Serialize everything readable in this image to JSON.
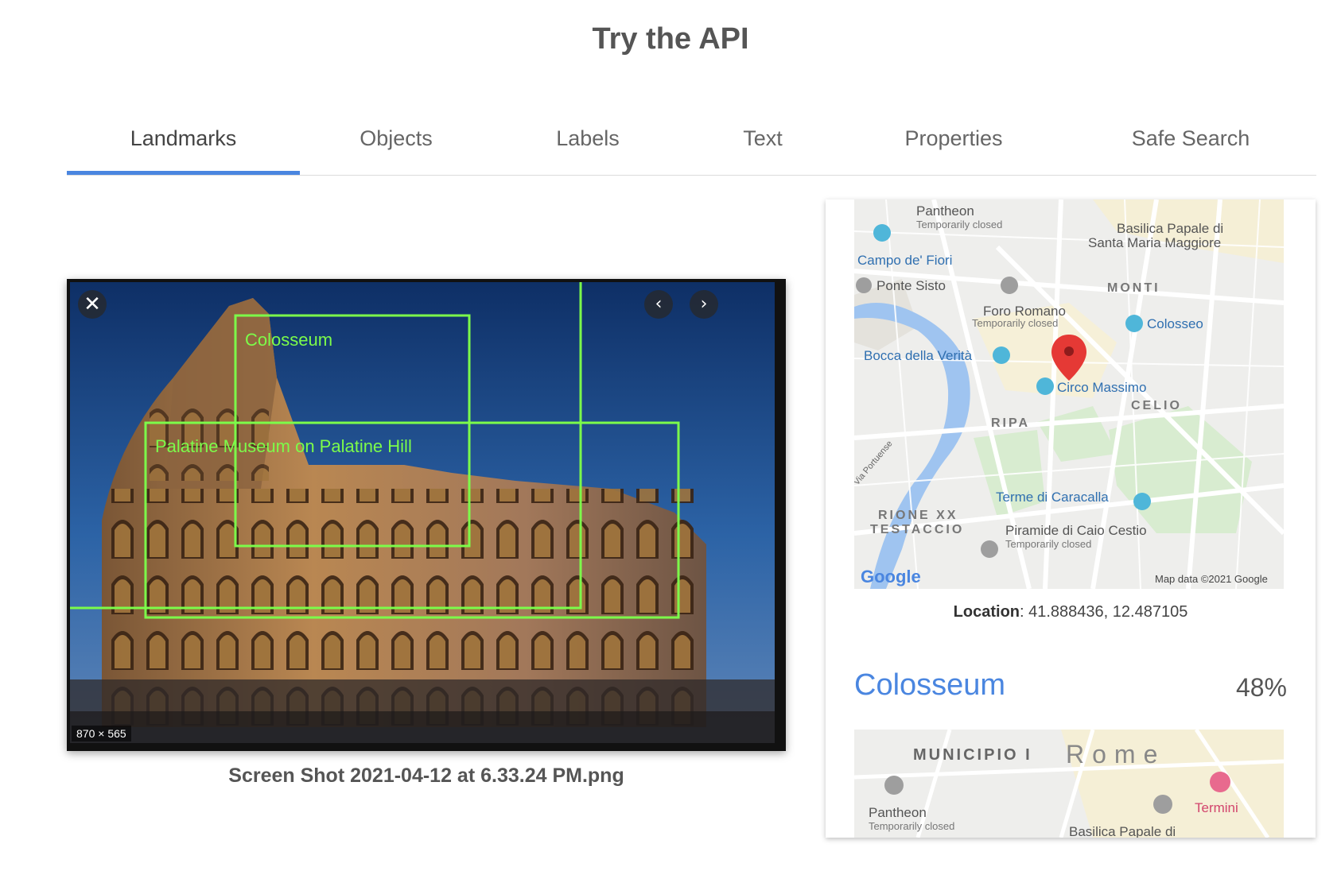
{
  "page": {
    "title": "Try the API"
  },
  "tabs": [
    {
      "label": "Landmarks",
      "active": true
    },
    {
      "label": "Objects"
    },
    {
      "label": "Labels"
    },
    {
      "label": "Text"
    },
    {
      "label": "Properties"
    },
    {
      "label": "Safe Search"
    }
  ],
  "viewer": {
    "dimensions": "870 × 565",
    "close_icon": "close-icon",
    "prev_icon": "chevron-left-icon",
    "next_icon": "chevron-right-icon",
    "annotations": [
      {
        "label": "Colosseum"
      },
      {
        "label": "Palatine Museum on Palatine Hill"
      }
    ],
    "box_color": "#7CFC4A",
    "filename": "Screen Shot 2021-04-12 at 6.33.24 PM.png"
  },
  "result": {
    "map": {
      "labels": {
        "pantheon": "Pantheon",
        "pantheon_status": "Temporarily closed",
        "basilica1": "Basilica Papale di",
        "basilica2": "Santa Maria Maggiore",
        "campo": "Campo de' Fiori",
        "ponte": "Ponte Sisto",
        "monti": "MONTI",
        "foro": "Foro Romano",
        "foro_status": "Temporarily closed",
        "colosseo": "Colosseo",
        "bocca": "Bocca della Verità",
        "circo": "Circo Massimo",
        "celio": "CELIO",
        "ripa": "RIPA",
        "portuense": "Via Portuense",
        "terme": "Terme di Caracalla",
        "rione1": "RIONE XX",
        "rione2": "TESTACCIO",
        "piramide": "Piramide di Caio Cestio",
        "piramide_status": "Temporarily closed",
        "google": "Google",
        "mapdata": "Map data ©2021 Google"
      }
    },
    "location_label": "Location",
    "location_value": ": 41.888436, 12.487105",
    "landmark": "Colosseum",
    "score": "48%",
    "map2": {
      "municipio": "MUNICIPIO I",
      "rome": "Rome",
      "pantheon": "Pantheon",
      "pantheon_status": "Temporarily closed",
      "termini": "Termini",
      "basilica": "Basilica Papale di"
    }
  }
}
